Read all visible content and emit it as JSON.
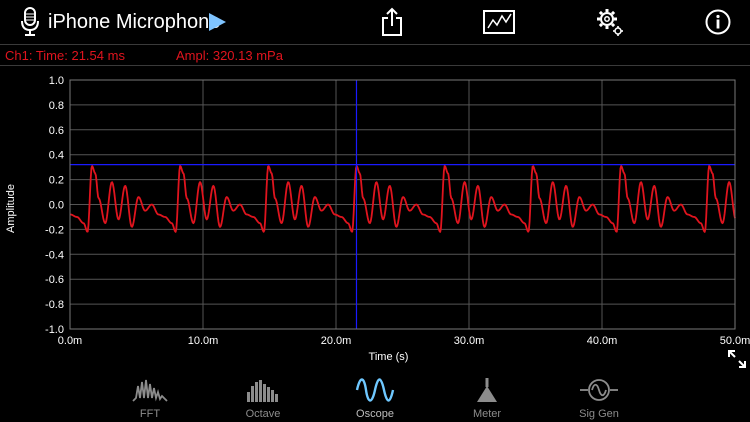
{
  "header": {
    "source_title": "iPhone Microphone",
    "icons": [
      "mic-icon",
      "play-icon",
      "share-icon",
      "display-icon",
      "settings-icon",
      "info-icon"
    ]
  },
  "readout": {
    "time": "Ch1:  Time: 21.54 ms",
    "amplitude": "Ampl: 320.13 mPa"
  },
  "colors": {
    "background": "#000000",
    "trace": "#e0141e",
    "cursor": "#1a1aff",
    "grid": "#555555",
    "readout_text": "#e0141e",
    "inactive_tab": "#8c8c8c",
    "active_tab_icon": "#6fc8ff"
  },
  "chart_data": {
    "type": "line",
    "xlabel": "Time (s)",
    "ylabel": "Amplitude",
    "xlim": [
      0,
      0.05
    ],
    "ylim": [
      -1.0,
      1.0
    ],
    "x_tick_labels": [
      "0.0m",
      "10.0m",
      "20.0m",
      "30.0m",
      "40.0m",
      "50.0m"
    ],
    "y_tick_labels": [
      "1.0",
      "0.8",
      "0.6",
      "0.4",
      "0.2",
      "0.0",
      "-0.2",
      "-0.4",
      "-0.6",
      "-0.8",
      "-1.0"
    ],
    "grid": true,
    "cursor": {
      "time": 0.02154,
      "amplitude": 0.32013
    },
    "series": [
      {
        "period": 0.00663,
        "phase": 0.00165,
        "waveform_time": [
          0,
          0.00025,
          0.0005,
          0.001,
          0.0015,
          0.002,
          0.0025,
          0.003,
          0.0035,
          0.004,
          0.0045,
          0.005,
          0.0055,
          0.006,
          0.0063,
          0.00663
        ],
        "waveform_amplitude": [
          0.31,
          0.25,
          0.05,
          -0.15,
          0.18,
          -0.12,
          0.15,
          -0.18,
          0.06,
          -0.05,
          0.0,
          -0.08,
          -0.1,
          -0.15,
          -0.22,
          0.31
        ]
      }
    ]
  },
  "tabs": [
    {
      "label": "FFT",
      "icon": "fft-icon",
      "active": false
    },
    {
      "label": "Octave",
      "icon": "octave-icon",
      "active": false
    },
    {
      "label": "Oscope",
      "icon": "oscope-icon",
      "active": true
    },
    {
      "label": "Meter",
      "icon": "meter-icon",
      "active": false
    },
    {
      "label": "Sig Gen",
      "icon": "siggen-icon",
      "active": false
    }
  ]
}
